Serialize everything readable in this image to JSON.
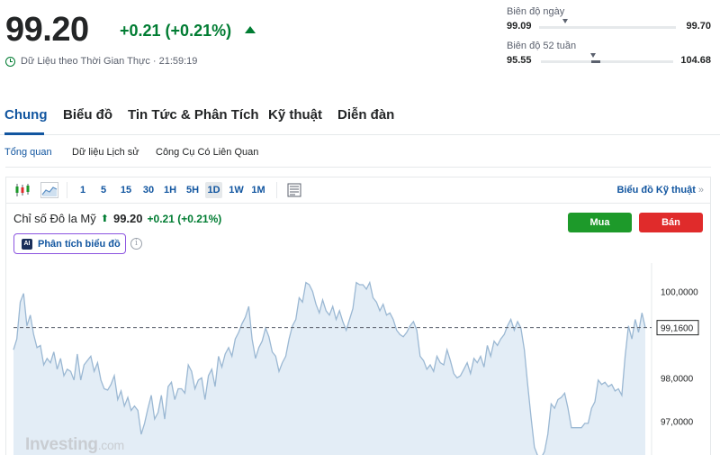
{
  "quote": {
    "price": "99.20",
    "change": "+0.21 (+0.21%)",
    "direction": "up",
    "realtime_label": "Dữ Liệu theo Thời Gian Thực · 21:59:19",
    "up_color": "#007c32"
  },
  "ranges": {
    "day": {
      "label": "Biên độ ngày",
      "low": "99.09",
      "high": "99.70"
    },
    "week52": {
      "label": "Biên độ 52 tuần",
      "low": "95.55",
      "high": "104.68"
    }
  },
  "main_tabs": [
    {
      "label": "Chung",
      "active": true
    },
    {
      "label": "Biểu đồ",
      "active": false
    },
    {
      "label": "Tin Tức & Phân Tích",
      "active": false
    },
    {
      "label": "Kỹ thuật",
      "active": false
    },
    {
      "label": "Diễn đàn",
      "active": false
    }
  ],
  "sub_tabs": [
    {
      "label": "Tổng quan",
      "active": true
    },
    {
      "label": "Dữ liệu Lịch sử",
      "active": false
    },
    {
      "label": "Công Cụ Có Liên Quan",
      "active": false
    }
  ],
  "toolbar": {
    "icons": [
      "candlestick-icon",
      "area-chart-icon",
      "layout-icon"
    ],
    "timeframes": [
      "1",
      "5",
      "15",
      "30",
      "1H",
      "5H",
      "1D",
      "1W",
      "1M"
    ],
    "selected_timeframe": "1D",
    "tech_link": "Biểu đồ Kỹ thuật",
    "tech_link_arrow": "»"
  },
  "chart_header": {
    "name": "Chỉ số Đô la Mỹ",
    "price": "99.20",
    "change": "+0.21 (+0.21%)",
    "ai_badge": "AI",
    "ai_button": "Phân tích biểu đồ",
    "info_symbol": "i",
    "buy": "Mua",
    "sell": "Bán",
    "buy_color": "#1d9a2a",
    "sell_color": "#e02b2b"
  },
  "watermark": {
    "brand": "Investing",
    "suffix": ".com"
  },
  "chart_data": {
    "type": "area",
    "ylim": [
      96.2,
      100.65
    ],
    "yticks": [
      {
        "value": 100.0,
        "label": "100,0000"
      },
      {
        "value": 98.0,
        "label": "98,0000"
      },
      {
        "value": 97.0,
        "label": "97,0000"
      }
    ],
    "last_value": 99.16,
    "last_value_label": "99,1600",
    "grid": false,
    "line_color": "#9bb8d3",
    "fill_color": "#e3edf6",
    "values": [
      98.65,
      98.9,
      99.75,
      99.95,
      99.2,
      99.45,
      99.0,
      98.7,
      98.75,
      98.3,
      98.45,
      98.35,
      98.6,
      98.2,
      98.45,
      98.05,
      98.2,
      98.15,
      97.95,
      98.55,
      97.95,
      98.3,
      98.4,
      98.5,
      98.15,
      98.35,
      97.95,
      97.75,
      97.72,
      97.85,
      98.05,
      97.5,
      97.7,
      97.35,
      97.55,
      97.25,
      97.35,
      97.25,
      96.7,
      96.95,
      97.3,
      97.6,
      97.05,
      97.2,
      97.6,
      97.05,
      97.8,
      97.9,
      97.5,
      97.75,
      97.75,
      97.65,
      98.3,
      98.15,
      97.75,
      97.95,
      98.0,
      97.5,
      98.05,
      98.2,
      97.8,
      98.5,
      98.25,
      98.55,
      98.7,
      98.5,
      98.9,
      99.05,
      99.25,
      99.4,
      99.65,
      98.9,
      98.45,
      98.7,
      98.85,
      99.15,
      98.95,
      98.6,
      98.5,
      98.15,
      98.35,
      98.5,
      98.9,
      99.2,
      99.35,
      99.85,
      99.75,
      100.2,
      100.15,
      100.0,
      99.7,
      99.5,
      99.8,
      99.55,
      99.45,
      99.65,
      99.35,
      99.55,
      99.3,
      99.1,
      99.35,
      99.6,
      100.2,
      100.15,
      100.15,
      100.05,
      100.2,
      99.85,
      99.75,
      99.55,
      99.7,
      99.45,
      99.5,
      99.35,
      99.1,
      99.0,
      98.95,
      99.05,
      99.2,
      99.3,
      99.1,
      98.5,
      98.4,
      98.2,
      98.3,
      98.15,
      98.5,
      98.35,
      98.3,
      98.65,
      98.4,
      98.1,
      98.0,
      98.05,
      98.2,
      98.35,
      98.1,
      98.45,
      98.35,
      98.5,
      98.25,
      98.75,
      98.5,
      98.85,
      98.75,
      98.9,
      99.0,
      99.2,
      99.35,
      99.1,
      99.3,
      99.15,
      98.65,
      97.85,
      97.1,
      96.4,
      96.2,
      96.15,
      96.3,
      96.7,
      97.4,
      97.3,
      97.5,
      97.55,
      97.65,
      97.3,
      96.85,
      96.85,
      96.85,
      96.85,
      96.95,
      96.95,
      97.3,
      97.45,
      97.95,
      97.85,
      97.9,
      97.8,
      97.85,
      97.7,
      97.75,
      97.6,
      98.5,
      99.2,
      98.9,
      99.35,
      99.05,
      99.5,
      99.16
    ]
  }
}
